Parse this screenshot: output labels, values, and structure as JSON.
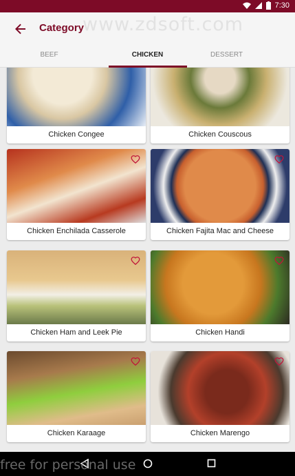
{
  "status": {
    "time": "7:30"
  },
  "appbar": {
    "title": "Category",
    "watermark": "www.zdsoft.com"
  },
  "tabs": [
    {
      "label": "BEEF",
      "active": false
    },
    {
      "label": "CHICKEN",
      "active": true
    },
    {
      "label": "DESSERT",
      "active": false
    }
  ],
  "recipes": [
    {
      "name": "Chicken Congee",
      "favorite_icon": false
    },
    {
      "name": "Chicken Couscous",
      "favorite_icon": false
    },
    {
      "name": "Chicken Enchilada Casserole",
      "favorite_icon": true
    },
    {
      "name": "Chicken Fajita Mac and Cheese",
      "favorite_icon": true
    },
    {
      "name": "Chicken Ham and Leek Pie",
      "favorite_icon": true
    },
    {
      "name": "Chicken Handi",
      "favorite_icon": true
    },
    {
      "name": "Chicken Karaage",
      "favorite_icon": true
    },
    {
      "name": "Chicken Marengo",
      "favorite_icon": true
    }
  ],
  "colors": {
    "primary": "#7d0b27",
    "heart": "#c0163a"
  },
  "footer": {
    "watermark": "free for personal use"
  }
}
